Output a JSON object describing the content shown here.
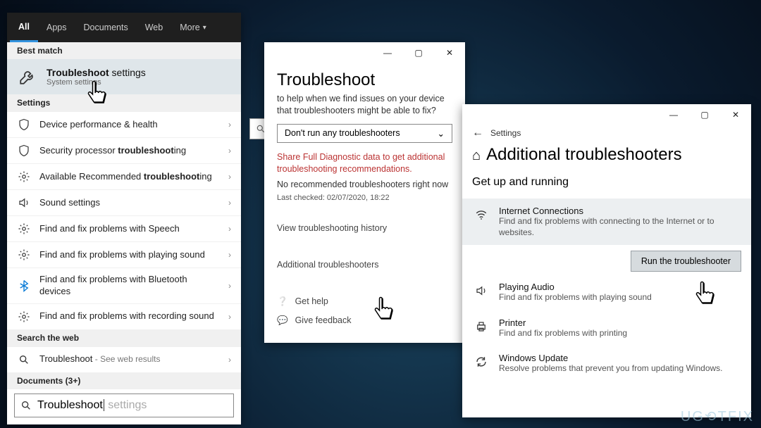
{
  "search": {
    "tabs": [
      "All",
      "Apps",
      "Documents",
      "Web",
      "More"
    ],
    "best_match_header": "Best match",
    "best_match_title_pre": "Troubleshoot",
    "best_match_title_post": " settings",
    "best_match_sub": "System settings",
    "settings_header": "Settings",
    "items": [
      {
        "icon": "shield",
        "pre": "Device performance & health",
        "bold": "",
        "post": ""
      },
      {
        "icon": "shield",
        "pre": "Security processor ",
        "bold": "troubleshoot",
        "post": "ing"
      },
      {
        "icon": "gear",
        "pre": "Available Recommended ",
        "bold": "troubleshoot",
        "post": "ing"
      },
      {
        "icon": "sound",
        "pre": "Sound settings",
        "bold": "",
        "post": ""
      },
      {
        "icon": "gear",
        "pre": "Find and fix problems with Speech",
        "bold": "",
        "post": ""
      },
      {
        "icon": "gear",
        "pre": "Find and fix problems with playing sound",
        "bold": "",
        "post": ""
      },
      {
        "icon": "bluetooth",
        "pre": "Find and fix problems with Bluetooth devices",
        "bold": "",
        "post": ""
      },
      {
        "icon": "gear",
        "pre": "Find and fix problems with recording sound",
        "bold": "",
        "post": ""
      }
    ],
    "web_header": "Search the web",
    "web_item": "Troubleshoot",
    "web_item_sub": " - See web results",
    "docs_header": "Documents (3+)",
    "input_value": "Troubleshoot",
    "input_ghost": " settings"
  },
  "troubleshoot_window": {
    "title": "Troubleshoot",
    "intro": "to help when we find issues on your device that troubleshooters might be able to fix?",
    "dropdown": "Don't run any troubleshooters",
    "warn": "Share Full Diagnostic data to get additional troubleshooting recommendations.",
    "no_rec": "No recommended troubleshooters right now",
    "last_checked": "Last checked: 02/07/2020, 18:22",
    "history": "View troubleshooting history",
    "additional": "Additional troubleshooters",
    "get_help": "Get help",
    "give_feedback": "Give feedback"
  },
  "additional_window": {
    "crumb_back": "←",
    "crumb_label": "Settings",
    "home_icon": "⌂",
    "title": "Additional troubleshooters",
    "section": "Get up and running",
    "run_label": "Run the troubleshooter",
    "items": [
      {
        "icon": "wifi",
        "title": "Internet Connections",
        "desc": "Find and fix problems with connecting to the Internet or to websites.",
        "selected": true
      },
      {
        "icon": "sound",
        "title": "Playing Audio",
        "desc": "Find and fix problems with playing sound",
        "selected": false
      },
      {
        "icon": "printer",
        "title": "Printer",
        "desc": "Find and fix problems with printing",
        "selected": false
      },
      {
        "icon": "update",
        "title": "Windows Update",
        "desc": "Resolve problems that prevent you from updating Windows.",
        "selected": false
      }
    ]
  },
  "window_buttons": {
    "min": "—",
    "max": "▢",
    "close": "✕"
  },
  "watermark": "UG⟲TFIX"
}
